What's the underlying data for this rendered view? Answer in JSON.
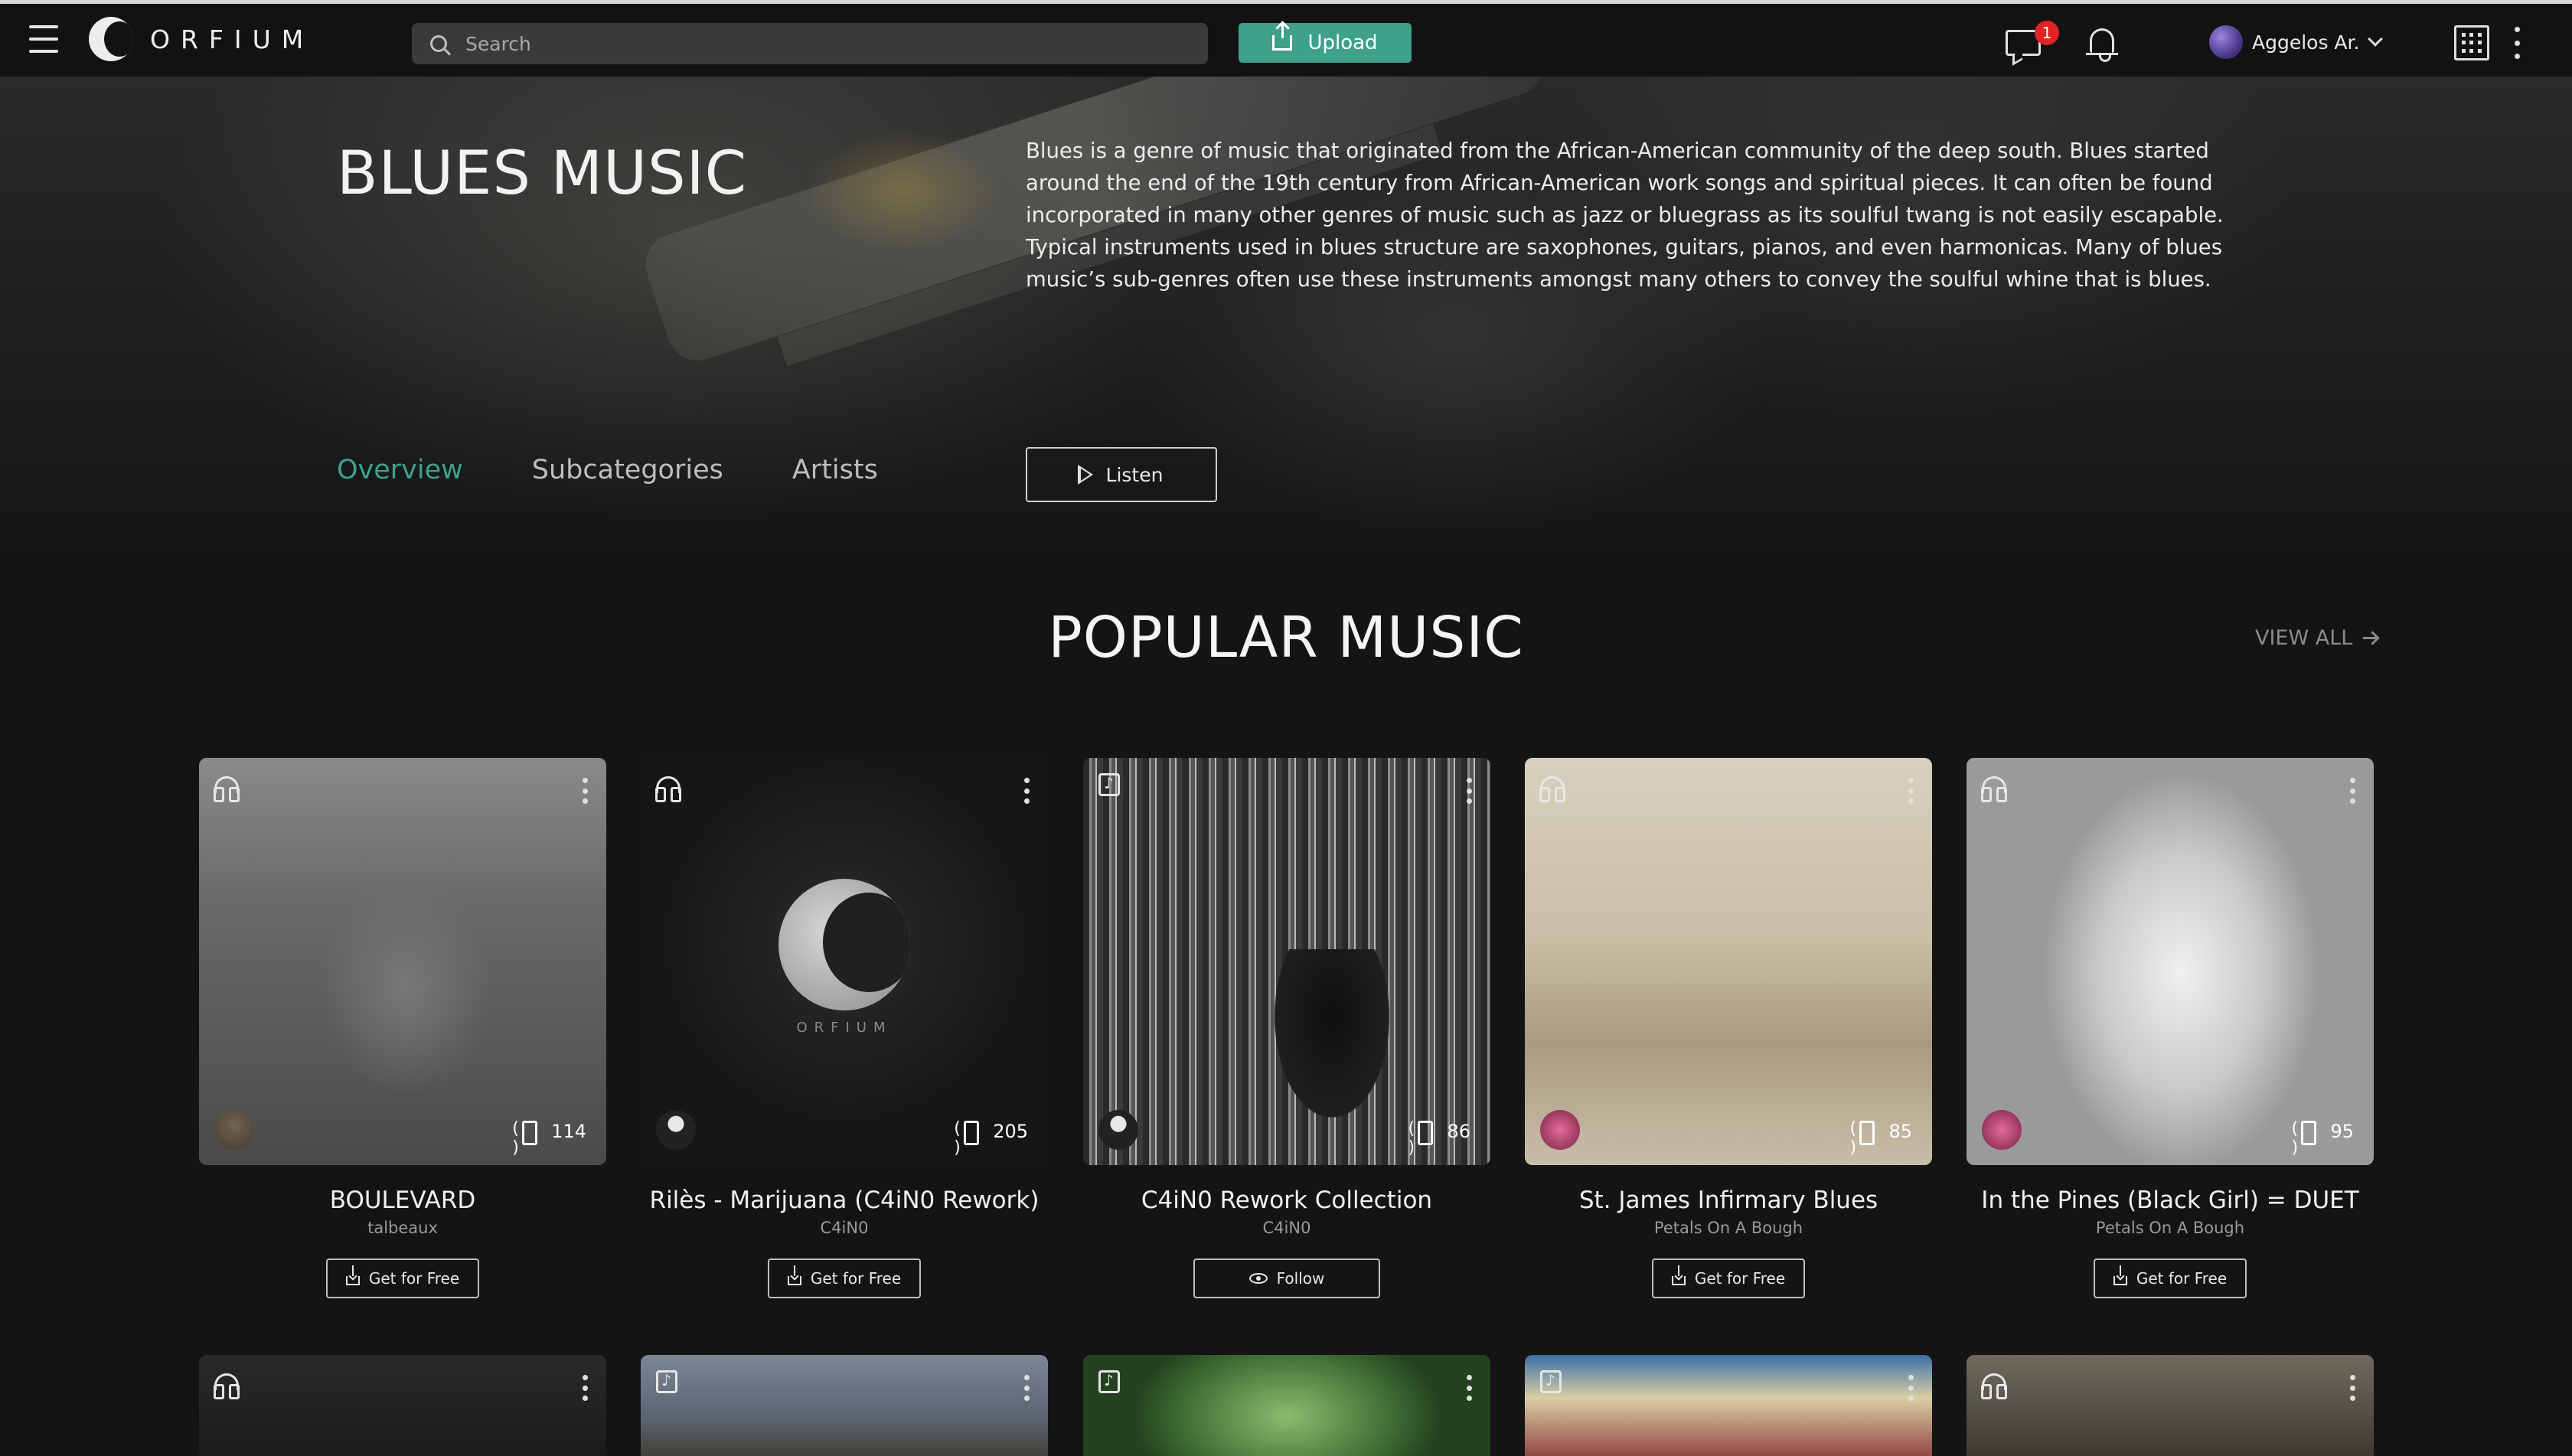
{
  "app": {
    "logo_text": "ORFIUM"
  },
  "header": {
    "search_placeholder": "Search",
    "upload_label": "Upload",
    "messages_badge": "1",
    "user_name": "Aggelos Ar."
  },
  "hero": {
    "title": "BLUES MUSIC",
    "description": "Blues is a genre of music that originated from the African-American community of the deep south. Blues started around the end of the 19th century from African-American work songs and spiritual pieces. It can often be found incorporated in many other genres of music such as jazz or bluegrass as its soulful twang is not easily escapable. Typical instruments used in blues structure are saxophones, guitars, pianos, and even harmonicas. Many of blues music’s sub-genres often use these instruments amongst many others to convey the soulful whine that is blues.",
    "tabs": [
      {
        "label": "Overview",
        "active": true
      },
      {
        "label": "Subcategories",
        "active": false
      },
      {
        "label": "Artists",
        "active": false
      }
    ],
    "listen_label": "Listen"
  },
  "section": {
    "title": "POPULAR MUSIC",
    "view_all_label": "VIEW ALL"
  },
  "cards": [
    {
      "type_icon": "headphones-icon",
      "title": "BOULEVARD",
      "owner": "talbeaux",
      "plays": "114",
      "action": "Get for Free",
      "action_icon": "download-icon"
    },
    {
      "type_icon": "headphones-icon",
      "title": "Rilès - Marijuana (C4iN0 Rework)",
      "owner": "C4iN0",
      "plays": "205",
      "action": "Get for Free",
      "action_icon": "download-icon",
      "art_text": "ORFIUM"
    },
    {
      "type_icon": "collection-icon",
      "title": "C4iN0 Rework Collection",
      "owner": "C4iN0",
      "plays": "86",
      "action": "Follow",
      "action_icon": "eye-icon"
    },
    {
      "type_icon": "headphones-icon",
      "title": "St. James Infirmary Blues",
      "owner": "Petals On A Bough",
      "plays": "85",
      "action": "Get for Free",
      "action_icon": "download-icon"
    },
    {
      "type_icon": "headphones-icon",
      "title": "In the Pines (Black Girl) = DUET",
      "owner": "Petals On A Bough",
      "plays": "95",
      "action": "Get for Free",
      "action_icon": "download-icon"
    }
  ],
  "cards_row2": [
    {
      "type_icon": "headphones-icon"
    },
    {
      "type_icon": "collection-icon"
    },
    {
      "type_icon": "collection-icon"
    },
    {
      "type_icon": "collection-icon"
    },
    {
      "type_icon": "headphones-icon"
    }
  ],
  "colors": {
    "accent": "#3fa08c",
    "badge": "#e02424",
    "background": "#141414"
  }
}
